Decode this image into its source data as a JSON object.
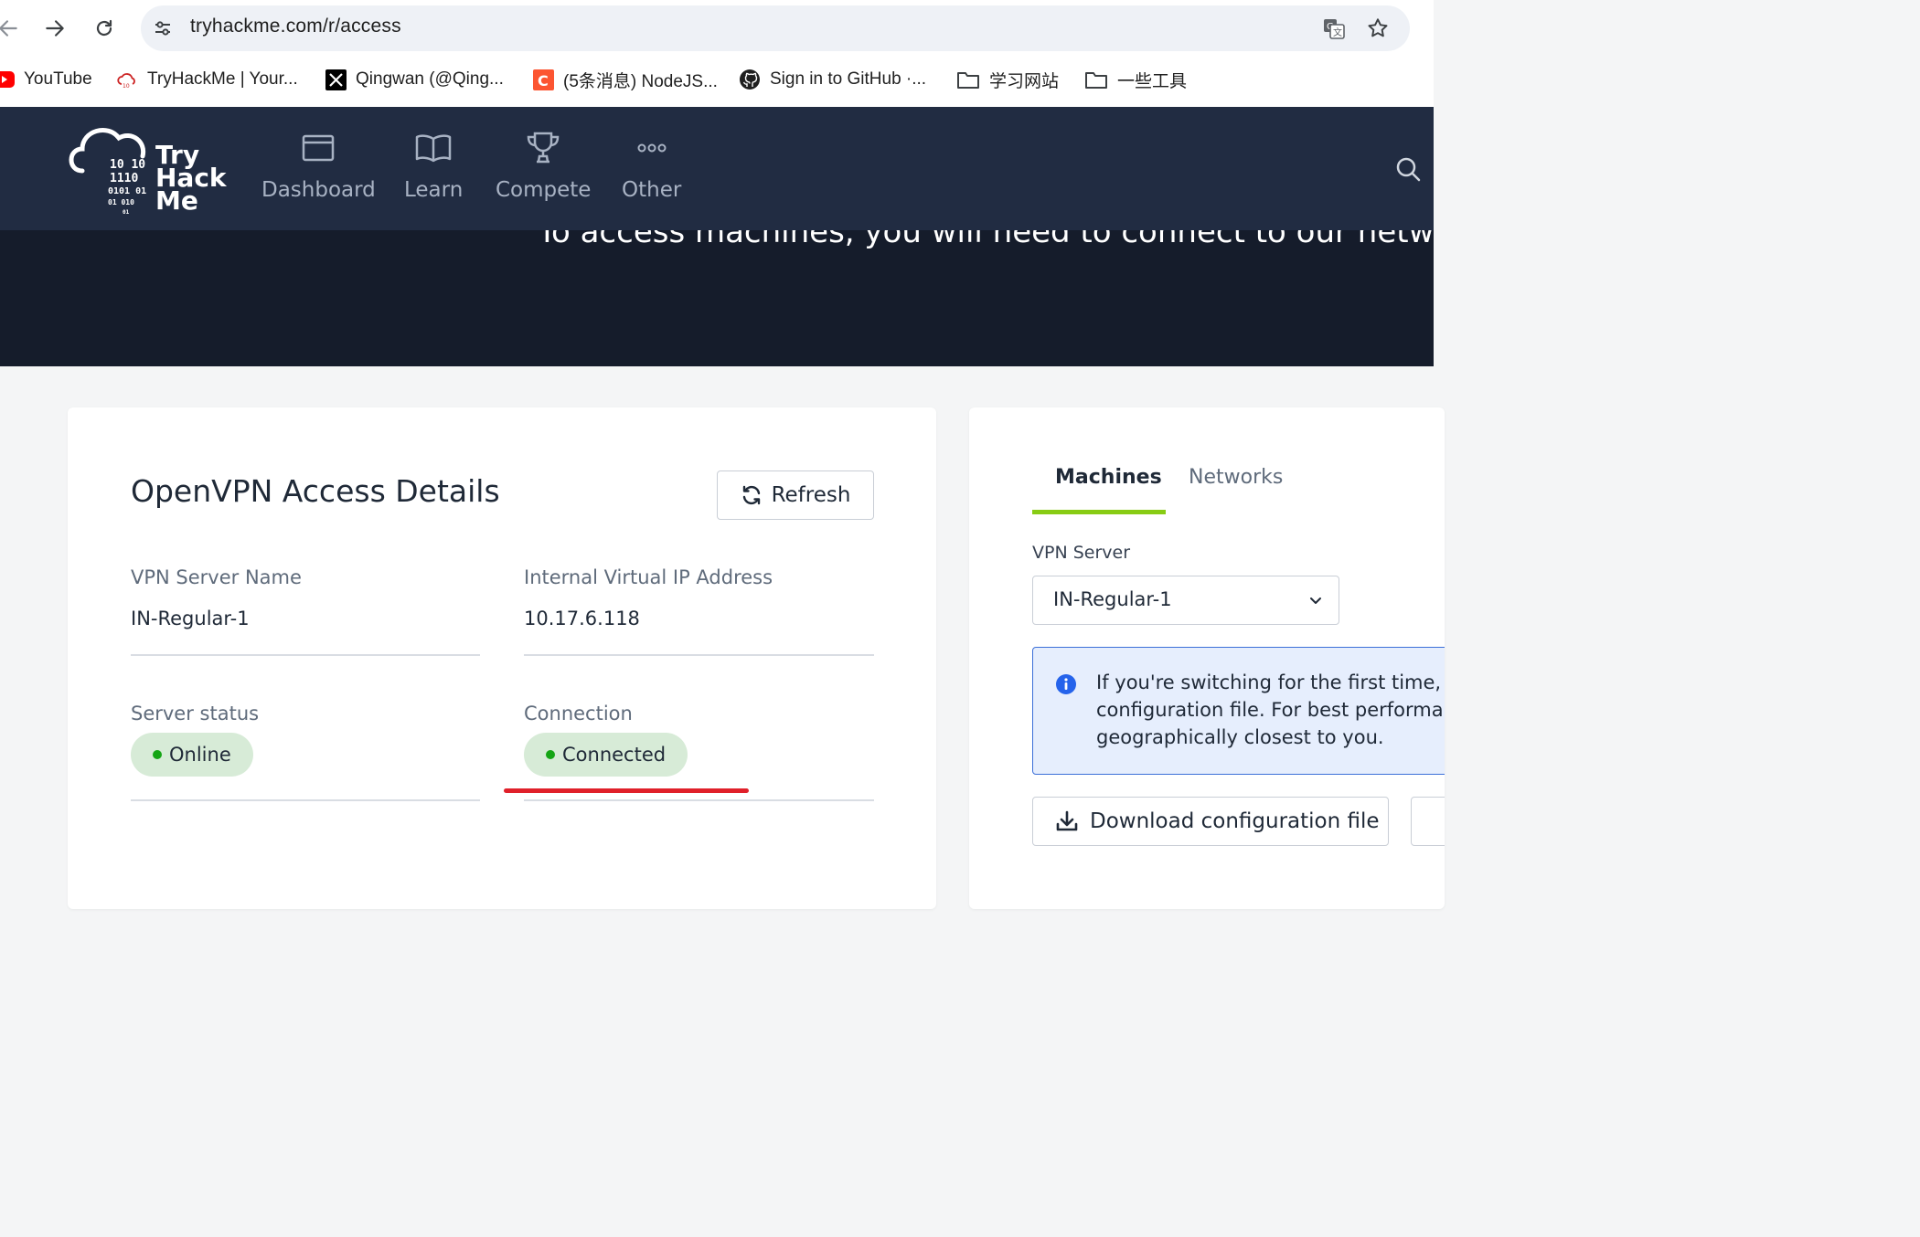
{
  "browser": {
    "url": "tryhackme.com/r/access",
    "bookmarks": [
      {
        "label": "YouTube",
        "icon": "youtube-icon"
      },
      {
        "label": "TryHackMe | Your...",
        "icon": "tryhackme-favicon"
      },
      {
        "label": "Qingwan (@Qing...",
        "icon": "x-icon"
      },
      {
        "label": "(5条消息) NodeJS...",
        "icon": "csdn-icon"
      },
      {
        "label": "Sign in to GitHub ·...",
        "icon": "github-icon"
      },
      {
        "label": "学习网站",
        "icon": "folder-icon"
      },
      {
        "label": "一些工具",
        "icon": "folder-icon"
      }
    ]
  },
  "site": {
    "logo": {
      "line1": "Try",
      "line2": "Hack",
      "line3": "Me",
      "binary": [
        "10  10",
        "1110",
        "0101  01",
        "01  010",
        "01"
      ]
    },
    "nav": [
      {
        "label": "Dashboard",
        "icon": "dashboard-icon"
      },
      {
        "label": "Learn",
        "icon": "book-icon"
      },
      {
        "label": "Compete",
        "icon": "trophy-icon"
      },
      {
        "label": "Other",
        "icon": "more-icon"
      }
    ],
    "hero_text": "To access machines, you will need to connect to our network."
  },
  "access_card": {
    "title": "OpenVPN Access Details",
    "refresh_label": "Refresh",
    "vpn_server_name_label": "VPN Server Name",
    "vpn_server_name_value": "IN-Regular-1",
    "internal_ip_label": "Internal Virtual IP Address",
    "internal_ip_value": "10.17.6.118",
    "server_status_label": "Server status",
    "server_status_value": "Online",
    "connection_label": "Connection",
    "connection_value": "Connected"
  },
  "config_card": {
    "tabs": [
      "Machines",
      "Networks"
    ],
    "active_tab": "Machines",
    "vpn_server_label": "VPN Server",
    "vpn_server_selected": "IN-Regular-1",
    "info_lines": [
      "If you're switching for the first time, y",
      "configuration file. For best performan",
      "geographically closest to you."
    ],
    "download_label": "Download configuration file"
  },
  "colors": {
    "nav_bg": "#212c42",
    "hero_bg": "#151c2b",
    "accent_green": "#88cc14",
    "status_pill_bg": "#d7ebd7",
    "status_dot": "#15a515",
    "info_border": "#3b6fd8",
    "annotation_red": "#e0202a"
  }
}
